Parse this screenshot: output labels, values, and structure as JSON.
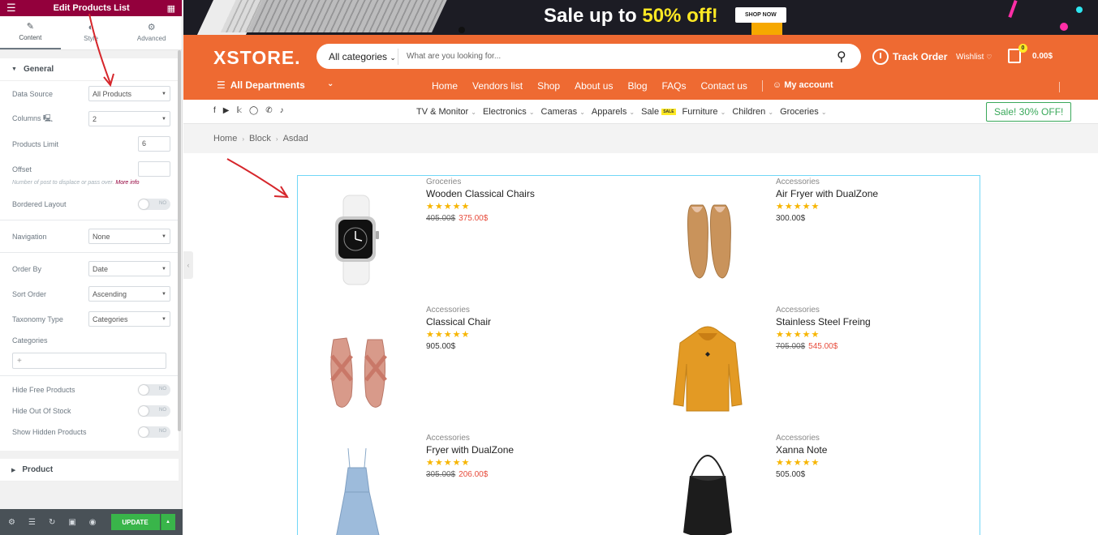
{
  "panel": {
    "title": "Edit Products List",
    "tabs": [
      {
        "label": "Content",
        "icon": "pencil-icon"
      },
      {
        "label": "Style",
        "icon": "contrast-icon"
      },
      {
        "label": "Advanced",
        "icon": "gear-icon"
      }
    ],
    "general_label": "General",
    "fields": {
      "data_source": {
        "label": "Data Source",
        "value": "All Products"
      },
      "columns": {
        "label": "Columns",
        "value": "2"
      },
      "products_limit": {
        "label": "Products Limit",
        "value": "6"
      },
      "offset": {
        "label": "Offset",
        "value": ""
      },
      "offset_note": "Number of post to displace or pass over.",
      "offset_note_link": "More info",
      "bordered_layout": {
        "label": "Bordered Layout",
        "value": "NO"
      },
      "navigation": {
        "label": "Navigation",
        "value": "None"
      },
      "order_by": {
        "label": "Order By",
        "value": "Date"
      },
      "sort_order": {
        "label": "Sort Order",
        "value": "Ascending"
      },
      "taxonomy_type": {
        "label": "Taxonomy Type",
        "value": "Categories"
      },
      "categories": {
        "label": "Categories"
      },
      "hide_free": {
        "label": "Hide Free Products",
        "value": "NO"
      },
      "hide_out_of_stock": {
        "label": "Hide Out Of Stock",
        "value": "NO"
      },
      "show_hidden": {
        "label": "Show Hidden Products",
        "value": "NO"
      }
    },
    "product_label": "Product",
    "update_label": "UPDATE"
  },
  "banner": {
    "sale_prefix": "Sale up to ",
    "sale_highlight": "50% off!",
    "shop_now": "SHOP NOW"
  },
  "header": {
    "logo": "XSTORE.",
    "search_category": "All categories",
    "search_placeholder": "What are you looking for...",
    "track_order": "Track Order",
    "wishlist": "Wishlist",
    "cart_count": "0",
    "cart_total": "0.00$",
    "all_departments": "All Departments",
    "nav": [
      "Home",
      "Vendors list",
      "Shop",
      "About us",
      "Blog",
      "FAQs",
      "Contact us"
    ],
    "my_account": "My account"
  },
  "subnav": {
    "categories": [
      "TV & Monitor",
      "Electronics",
      "Cameras",
      "Apparels",
      "Sale",
      "Furniture",
      "Children",
      "Groceries"
    ],
    "sale_badge": "SALE",
    "promo": "Sale! 30% OFF!"
  },
  "breadcrumb": [
    "Home",
    "Block",
    "Asdad"
  ],
  "products": [
    {
      "category": "Groceries",
      "name": "Wooden Classical Chairs",
      "rating": 5,
      "old_price": "405.00$",
      "price": "375.00$",
      "image": "smartwatch"
    },
    {
      "category": "Accessories",
      "name": "Air Fryer with DualZone",
      "rating": 5,
      "old_price": "",
      "price": "300.00$",
      "image": "shoes"
    },
    {
      "category": "Accessories",
      "name": "Classical Chair",
      "rating": 5,
      "old_price": "",
      "price": "905.00$",
      "image": "sandals"
    },
    {
      "category": "Accessories",
      "name": "Stainless Steel Freing",
      "rating": 5,
      "old_price": "705.00$",
      "price": "545.00$",
      "image": "hoodie"
    },
    {
      "category": "Accessories",
      "name": "Fryer with DualZone",
      "rating": 5,
      "old_price": "305.00$",
      "price": "206.00$",
      "image": "dress"
    },
    {
      "category": "Accessories",
      "name": "Xanna Note",
      "rating": 5,
      "old_price": "",
      "price": "505.00$",
      "image": "bag"
    }
  ],
  "colors": {
    "panel_header": "#93003c",
    "header_orange": "#ee6a32",
    "sale_yellow": "#ffe924",
    "update_green": "#39b54a",
    "promo_green": "#3aa85a",
    "sale_price": "#e74c3c",
    "grid_border": "#71d7f7",
    "annotation_red": "#d6262b"
  }
}
